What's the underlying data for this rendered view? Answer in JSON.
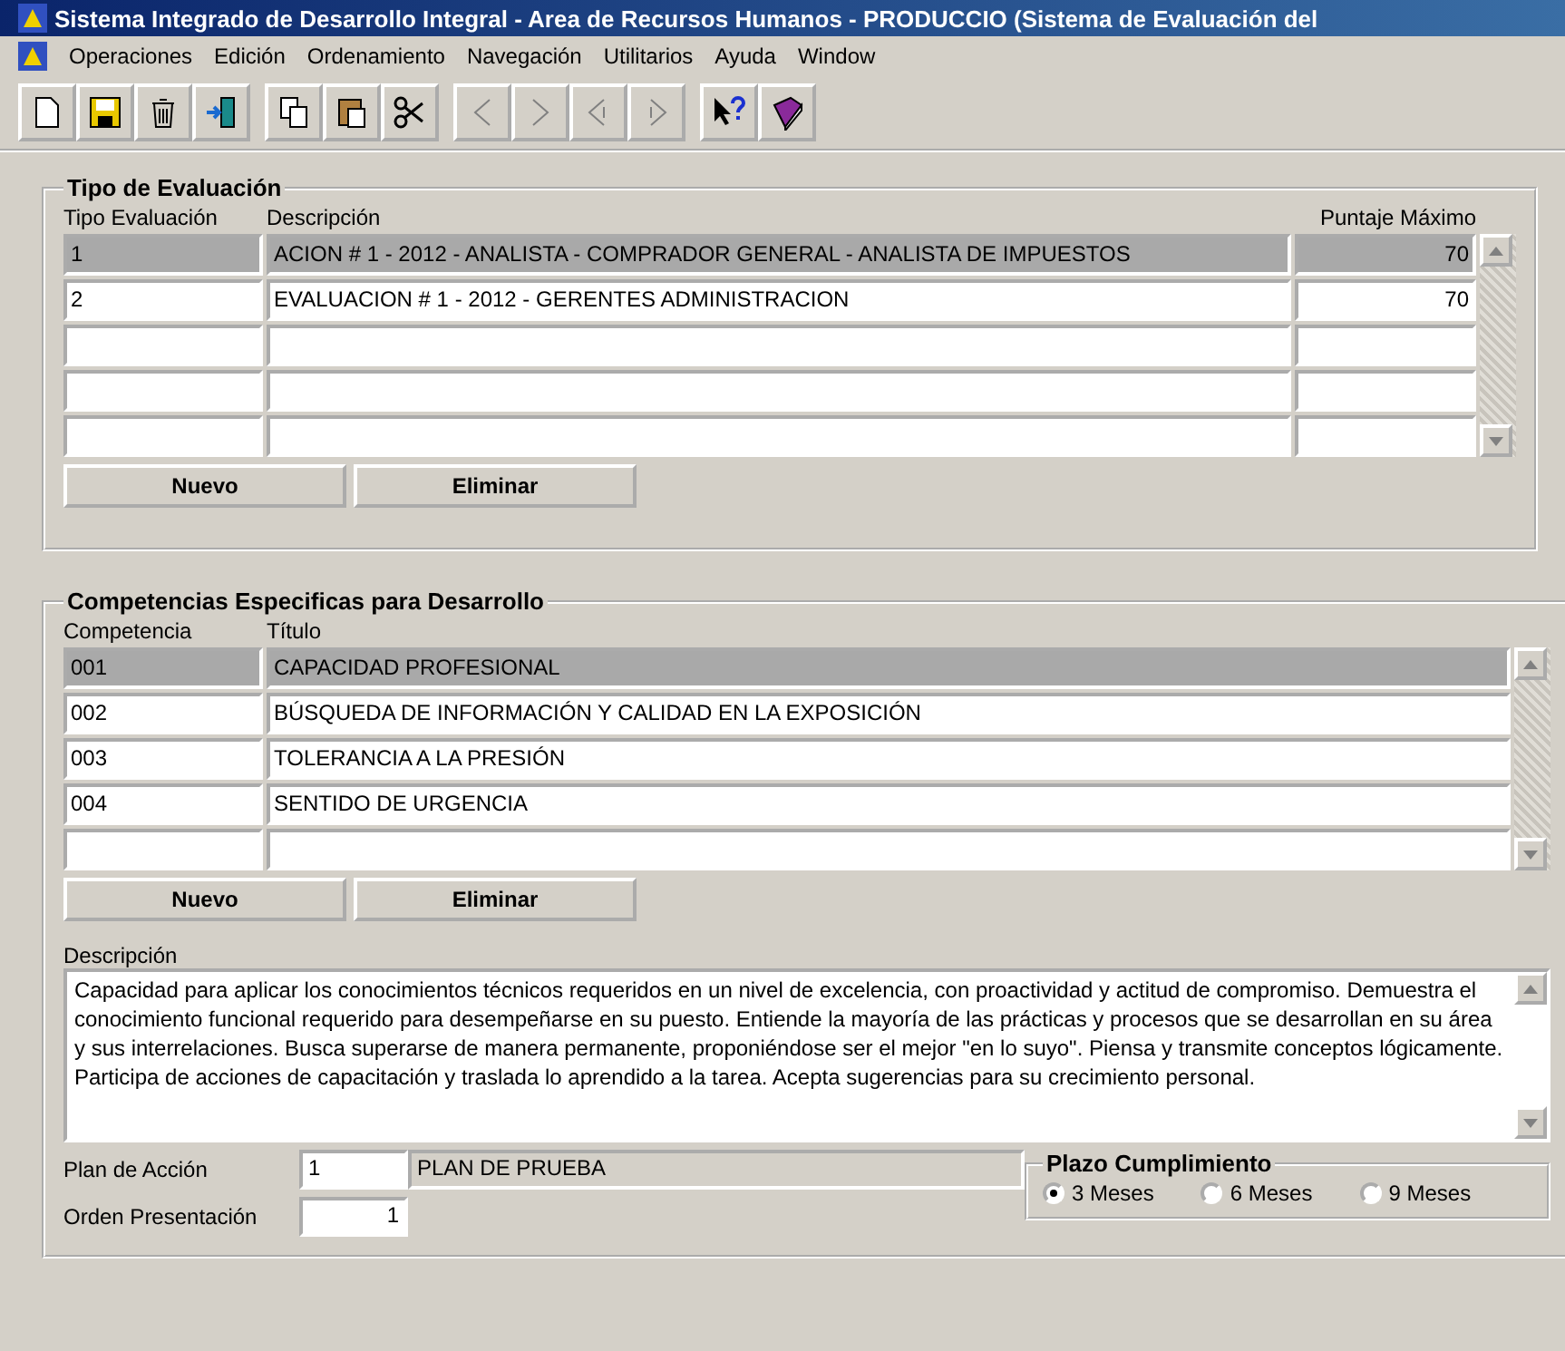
{
  "window": {
    "title": "Sistema Integrado de Desarrollo Integral - Area de Recursos Humanos - PRODUCCIO  (Sistema de Evaluación del"
  },
  "menu": [
    "Operaciones",
    "Edición",
    "Ordenamiento",
    "Navegación",
    "Utilitarios",
    "Ayuda",
    "Window"
  ],
  "toolbar": [
    {
      "buttons": [
        {
          "kind": "new"
        },
        {
          "kind": "save"
        },
        {
          "kind": "delete"
        },
        {
          "kind": "exit"
        }
      ]
    },
    {
      "buttons": [
        {
          "kind": "copy"
        },
        {
          "kind": "paste"
        },
        {
          "kind": "cut"
        }
      ]
    },
    {
      "buttons": [
        {
          "kind": "prev"
        },
        {
          "kind": "next"
        },
        {
          "kind": "prevset"
        },
        {
          "kind": "nextset"
        }
      ]
    },
    {
      "buttons": [
        {
          "kind": "help"
        },
        {
          "kind": "book"
        }
      ]
    }
  ],
  "tipo_evaluacion": {
    "title": "Tipo de Evaluación",
    "columns": [
      "Tipo Evaluación",
      "Descripción",
      "Puntaje Máximo"
    ],
    "rows": [
      {
        "cells": [
          "1",
          "ACION # 1 - 2012 - ANALISTA - COMPRADOR GENERAL - ANALISTA DE IMPUESTOS",
          "70"
        ],
        "selected": true
      },
      {
        "cells": [
          "2",
          "EVALUACION # 1 - 2012 - GERENTES ADMINISTRACION",
          "70"
        ],
        "selected": false
      },
      {
        "cells": [
          "",
          "",
          ""
        ],
        "selected": false
      },
      {
        "cells": [
          "",
          "",
          ""
        ],
        "selected": false
      },
      {
        "cells": [
          "",
          "",
          ""
        ],
        "selected": false
      }
    ],
    "buttons": [
      "Nuevo",
      "Eliminar"
    ]
  },
  "competencias": {
    "title": "Competencias Especificas para Desarrollo",
    "columns": [
      "Competencia",
      "Título"
    ],
    "rows": [
      {
        "cells": [
          "001",
          "CAPACIDAD PROFESIONAL"
        ],
        "selected": true
      },
      {
        "cells": [
          "002",
          "BÚSQUEDA DE INFORMACIÓN Y CALIDAD EN LA EXPOSICIÓN"
        ],
        "selected": false
      },
      {
        "cells": [
          "003",
          "TOLERANCIA A LA PRESIÓN"
        ],
        "selected": false
      },
      {
        "cells": [
          "004",
          "SENTIDO DE URGENCIA"
        ],
        "selected": false
      },
      {
        "cells": [
          "",
          ""
        ],
        "selected": false
      }
    ],
    "buttons": [
      "Nuevo",
      "Eliminar"
    ],
    "description_label": "Descripción",
    "description": "Capacidad para aplicar los conocimientos técnicos requeridos en un nivel de excelencia, con proactividad y actitud de compromiso. Demuestra el conocimiento funcional requerido para desempeñarse en su puesto. Entiende la mayoría de las prácticas y procesos que se desarrollan en su área y sus interrelaciones. Busca superarse de manera permanente, proponiéndose ser el mejor \"en lo suyo\". Piensa y transmite conceptos lógicamente. Participa de acciones de capacitación y traslada lo aprendido a la tarea. Acepta sugerencias para su crecimiento personal.",
    "plan_label": "Plan de Acción",
    "plan_code": "1",
    "plan_name": "PLAN DE PRUEBA",
    "orden_label": "Orden Presentación",
    "orden_value": "1",
    "plazo": {
      "title": "Plazo Cumplimiento",
      "options": [
        {
          "label": "3 Meses",
          "selected": true
        },
        {
          "label": "6 Meses",
          "selected": false
        },
        {
          "label": "9 Meses",
          "selected": false
        }
      ]
    }
  }
}
